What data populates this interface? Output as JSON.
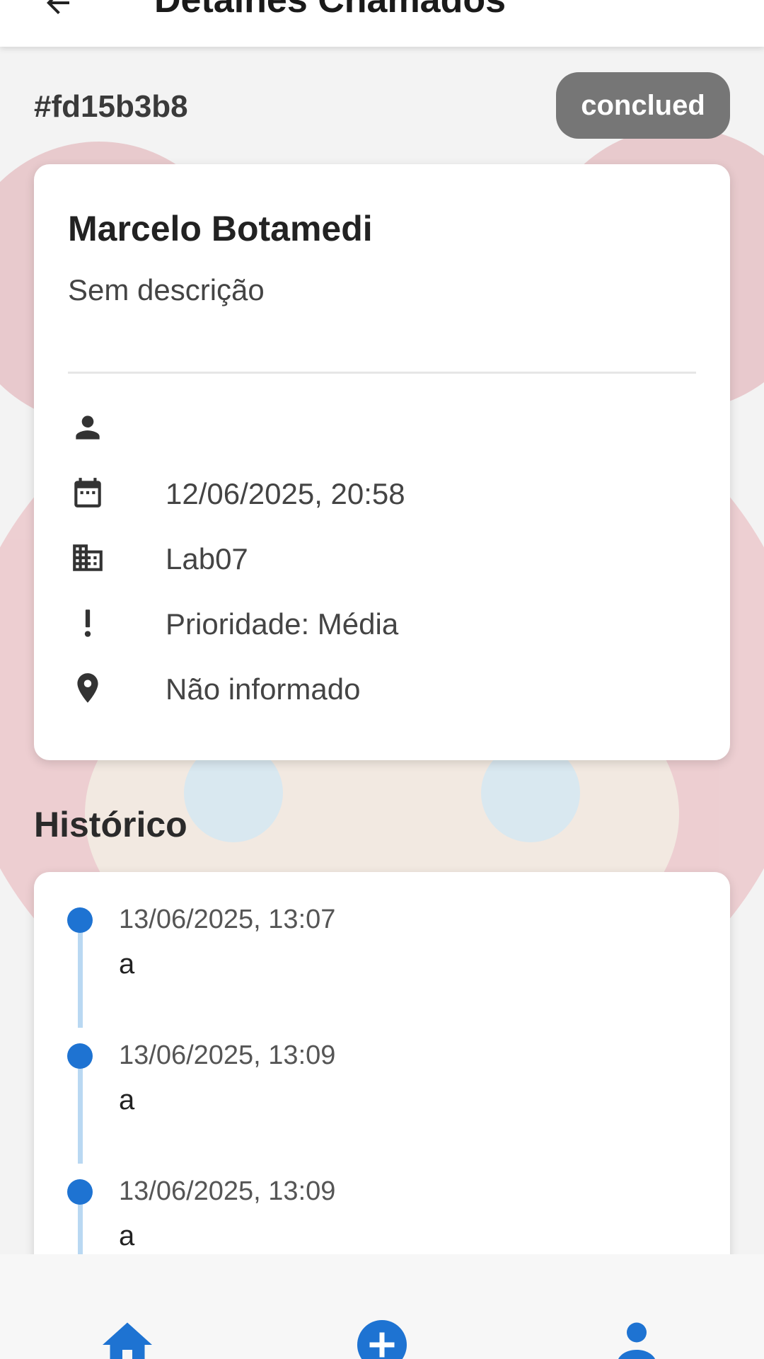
{
  "header": {
    "title": "Detalhes Chamados",
    "back_icon": "arrow-back-icon"
  },
  "ticket": {
    "id": "#fd15b3b8",
    "status": "conclued",
    "status_color": "#767676"
  },
  "details": {
    "requester_name": "Marcelo Botamedi",
    "description": "Sem descrição",
    "rows": [
      {
        "icon": "person-icon",
        "text": ""
      },
      {
        "icon": "calendar-icon",
        "text": "12/06/2025, 20:58"
      },
      {
        "icon": "building-icon",
        "text": "Lab07"
      },
      {
        "icon": "exclamation-icon",
        "text": "Prioridade: Média"
      },
      {
        "icon": "location-pin-icon",
        "text": "Não informado"
      }
    ]
  },
  "history": {
    "title": "Histórico",
    "accent_color": "#1e73d2",
    "entries": [
      {
        "date": "13/06/2025, 13:07",
        "text": "a"
      },
      {
        "date": "13/06/2025, 13:09",
        "text": "a"
      },
      {
        "date": "13/06/2025, 13:09",
        "text": "a"
      }
    ]
  },
  "bottom_nav": {
    "items": [
      {
        "icon": "home-icon"
      },
      {
        "icon": "add-circle-icon"
      },
      {
        "icon": "profile-icon"
      }
    ],
    "active_color": "#1e73d2"
  }
}
